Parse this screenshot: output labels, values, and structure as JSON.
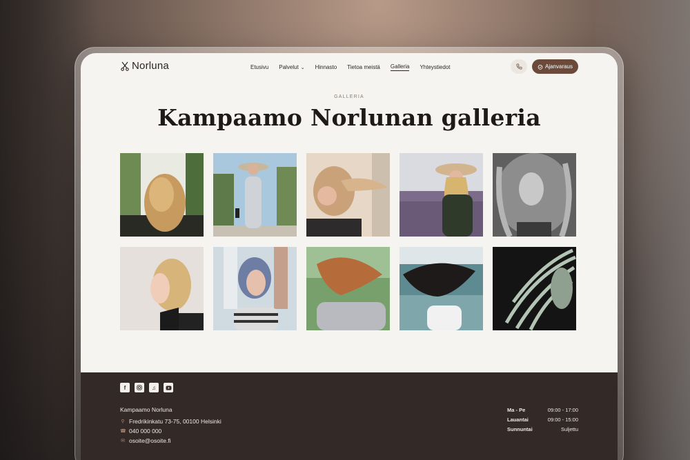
{
  "brand": {
    "name": "Norluna",
    "icon": "scissors-icon"
  },
  "nav": {
    "items": [
      {
        "label": "Etusivu"
      },
      {
        "label": "Palvelut",
        "has_dropdown": true
      },
      {
        "label": "Hinnasto"
      },
      {
        "label": "Tietoa meistä"
      },
      {
        "label": "Galleria",
        "active": true
      },
      {
        "label": "Yhteystiedot"
      }
    ],
    "phone_icon": "phone-icon",
    "booking_label": "Ajanvaraus",
    "booking_icon": "calendar-icon"
  },
  "hero": {
    "eyebrow": "GALLERIA",
    "title": "Kampaamo Norlunan galleria"
  },
  "gallery": {
    "images": [
      "wavy-blonde-hair-back-view",
      "woman-in-sunhat-on-street",
      "woman-with-flowing-blonde-hair",
      "woman-in-hat-lavender-field",
      "black-and-white-curly-hair",
      "blonde-bob-profile",
      "blue-grey-bob-haircut",
      "woman-tossing-auburn-hair",
      "dark-hair-blowing-by-sea",
      "silver-hair-on-black-background"
    ]
  },
  "footer": {
    "socials": [
      "facebook-icon",
      "instagram-icon",
      "tiktok-icon",
      "youtube-icon"
    ],
    "business_name": "Kampaamo Norluna",
    "address": "Fredrikinkatu 73-75, 00100 Helsinki",
    "phone": "040 000 000",
    "email": "osoite@osoite.fi",
    "hours": [
      {
        "day": "Ma - Pe",
        "time": "09:00 - 17:00"
      },
      {
        "day": "Lauantai",
        "time": "09:00 - 15:00"
      },
      {
        "day": "Sunnuntai",
        "time": "Suljettu"
      }
    ]
  },
  "colors": {
    "accent": "#6b4a3c",
    "page_bg": "#f6f4f0",
    "footer_bg": "#332a28"
  }
}
